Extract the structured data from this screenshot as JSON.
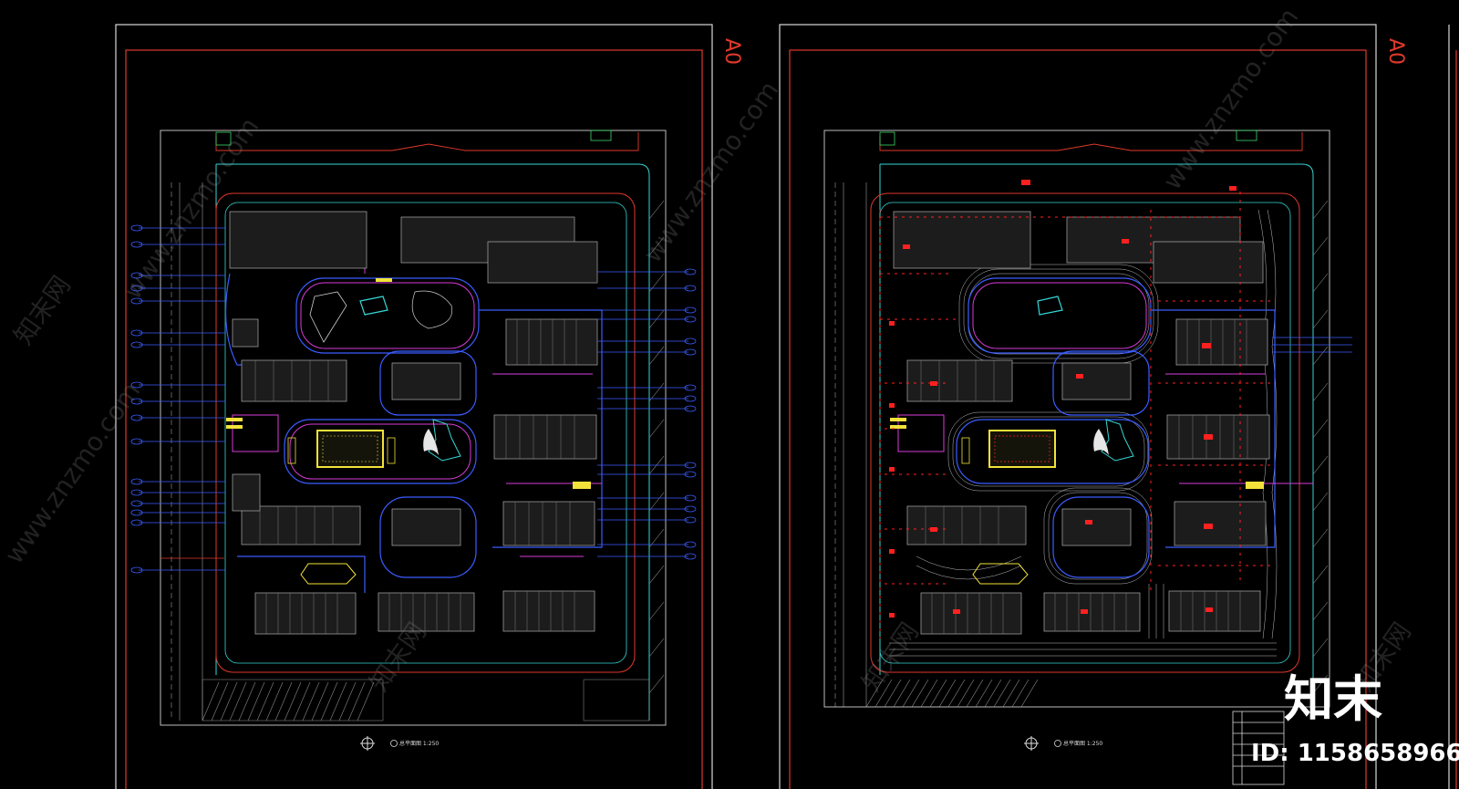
{
  "sheets": [
    {
      "sheet_label": "A0",
      "scale_note": "总平面图  1:250"
    },
    {
      "sheet_label": "A0",
      "scale_note": "总平面图  1:250"
    }
  ],
  "watermark": {
    "site": "www.znzmo.com",
    "brand": "知末网"
  },
  "badge": {
    "logo": "知末",
    "id_text": "ID: 1158658966"
  },
  "colors": {
    "background": "#000000",
    "frame_white": "#d9d9d9",
    "frame_red": "#e0392b",
    "road_cyan": "#37d6d6",
    "path_blue": "#3b5cff",
    "path_magenta": "#d93bd9",
    "building_gray": "#9c9c9c",
    "plaza_yellow": "#f2e23a",
    "annotation_red": "#ff2020"
  }
}
